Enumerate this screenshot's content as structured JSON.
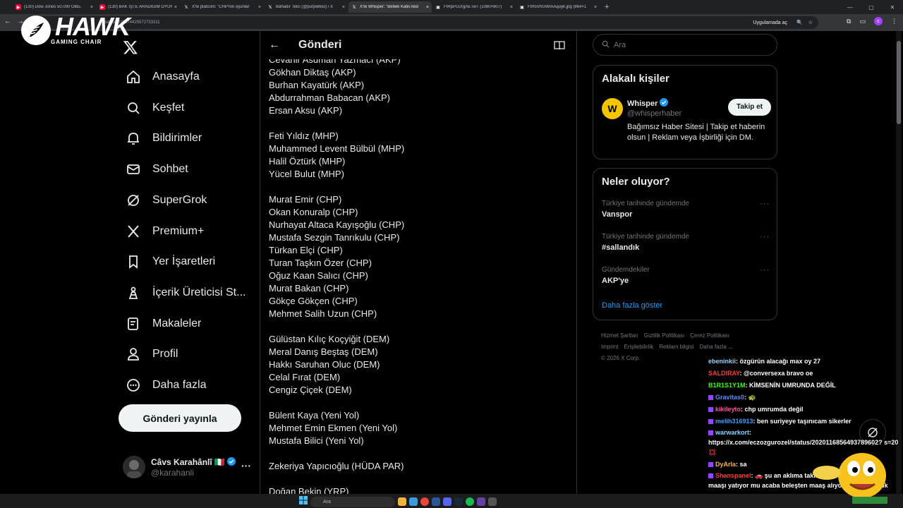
{
  "browser": {
    "tabs": [
      {
        "title": "(130) Dow Jones 50.000 Oldu.",
        "icon": "youtube-icon",
        "active": false
      },
      {
        "title": "(130) BAK İŞTE ARADIĞIM OYUN",
        "icon": "youtube-icon",
        "active": false
      },
      {
        "title": "X'te platcom: \"CHP'nin oyunlar",
        "icon": "x-icon",
        "active": false
      },
      {
        "title": "Bahadır Telci (@purplebisi) / X",
        "icon": "x-icon",
        "active": false
      },
      {
        "title": "X'te Whisper: \"Bebek Katili Abd",
        "icon": "x-icon",
        "active": true
      },
      {
        "title": "FtRpPcsXgAETwT (1080×807)",
        "icon": "image-icon",
        "active": false
      },
      {
        "title": "FtR5VhGWIAAquyk.jpg (864×1",
        "icon": "image-icon",
        "active": false
      }
    ],
    "url": "status/2019074425572733311",
    "app_chip": "Uygulamada aç",
    "profile_letter": "c"
  },
  "overlay": {
    "brand": "HAWK",
    "brand_sub": "GAMING CHAIR"
  },
  "nav": {
    "items": [
      {
        "label": "Anasayfa",
        "icon": "home-icon"
      },
      {
        "label": "Keşfet",
        "icon": "search-icon"
      },
      {
        "label": "Bildirimler",
        "icon": "bell-icon"
      },
      {
        "label": "Sohbet",
        "icon": "mail-icon"
      },
      {
        "label": "SuperGrok",
        "icon": "grok-icon"
      },
      {
        "label": "Premium+",
        "icon": "x-premium-icon"
      },
      {
        "label": "Yer İşaretleri",
        "icon": "bookmark-icon"
      },
      {
        "label": "İçerik Üreticisi St...",
        "icon": "creator-studio-icon"
      },
      {
        "label": "Makaleler",
        "icon": "articles-icon"
      },
      {
        "label": "Profil",
        "icon": "profile-icon"
      },
      {
        "label": "Daha fazla",
        "icon": "more-circle-icon"
      }
    ],
    "post_button": "Gönderi yayınla",
    "account": {
      "name": "Câvs Karahânlî",
      "flag": "🇮🇹",
      "handle": "@karahanli"
    }
  },
  "post": {
    "header": "Gönderi",
    "lines": [
      "Cevahir Asuman Yazmacı (AKP)",
      "Gökhan Diktaş (AKP)",
      "Burhan Kayatürk (AKP)",
      "Abdurrahman Babacan (AKP)",
      "Ersan Aksu (AKP)",
      "",
      "Feti Yıldız (MHP)",
      "Muhammed Levent Bülbül (MHP)",
      "Halil Öztürk (MHP)",
      "Yücel Bulut (MHP)",
      "",
      "Murat Emir (CHP)",
      "Okan Konuralp (CHP)",
      "Nurhayat Altaca Kayışoğlu (CHP)",
      "Mustafa Sezgin Tanrıkulu (CHP)",
      "Türkan Elçi (CHP)",
      "Turan Taşkın Özer (CHP)",
      "Oğuz Kaan Salıcı (CHP)",
      "Murat Bakan (CHP)",
      "Gökçe Gökçen (CHP)",
      "Mehmet Salih Uzun (CHP)",
      "",
      "Gülüstan Kılıç Koçyiğit (DEM)",
      "Meral Danış Beştaş (DEM)",
      "Hakkı Saruhan Oluc (DEM)",
      "Celal Fırat (DEM)",
      "Cengiz Çiçek (DEM)",
      "",
      "Bülent Kaya (Yeni Yol)",
      "Mehmet Emin Ekmen (Yeni Yol)",
      "Mustafa Bilici (Yeni Yol)",
      "",
      "Zekeriya Yapıcıoğlu (HÜDA PAR)",
      "",
      "Doğan Bekin (YRP)"
    ]
  },
  "right": {
    "search_placeholder": "Ara",
    "related": {
      "title": "Alakalı kişiler",
      "name": "Whisper",
      "handle": "@whisperhaber",
      "follow": "Takip et",
      "bio": "Bağımsız Haber Sitesi | Takip et haberin olsun | Reklam veya İşbirliği için DM."
    },
    "trends": {
      "title": "Neler oluyor?",
      "items": [
        {
          "context": "Türkiye tarihinde gündemde",
          "name": "Vanspor"
        },
        {
          "context": "Türkiye tarihinde gündemde",
          "name": "#sallandık"
        },
        {
          "context": "Gündemdekiler",
          "name": "AKP'ye"
        }
      ],
      "show_more": "Daha fazla göster"
    },
    "footer": [
      "Hizmet Şartları",
      "Gizlilik Politikası",
      "Çerez Politikası",
      "Imprint",
      "Erişilebilirlik",
      "Reklam bilgisi",
      "Daha fazla ...",
      "© 2026 X Corp."
    ]
  },
  "chat": [
    {
      "user": "ebeninkii",
      "color": "#9bd1ff",
      "text": ": özgürün alacağı max oy 27"
    },
    {
      "user": "SALDIRAY",
      "color": "#ff3b3b",
      "text": ": @conversexa bravo oe"
    },
    {
      "user": "B1R1S1Y1M",
      "color": "#39ff14",
      "text": ": KİMSENİN UMRUNDA DEĞİL"
    },
    {
      "user": "Gravitas0",
      "color": "#5b8cff",
      "text": ": 🐢"
    },
    {
      "user": "kikileyto",
      "color": "#ff4fa3",
      "text": ": chp umrumda değil"
    },
    {
      "user": "melih316913",
      "color": "#3ea0ff",
      "text": ": ben suriyeye taşınıcam sikerler"
    },
    {
      "user": "warwarkort",
      "color": "#8ad1ff",
      "text": ": https://x.com/eczozgurozel/status/2020116856493789602? s=20 💢"
    },
    {
      "user": "DyArla",
      "color": "#ffb347",
      "text": ": sa"
    },
    {
      "user": "Shanspanel",
      "color": "#ff3b3b",
      "text": ": 🚗 şu an aklıma takıldı amk ekoçeşmeyken maaşı yatıyor mu acaba beleşten maaş alıyor olmasın lavuk"
    }
  ],
  "taskbar": {
    "search": "Ara"
  }
}
